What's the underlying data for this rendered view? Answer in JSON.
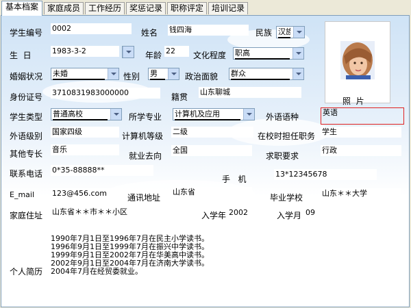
{
  "tabs": [
    "基本档案",
    "家庭成员",
    "工作经历",
    "奖惩记录",
    "职称评定",
    "培训记录"
  ],
  "labels": {
    "student_id": "学生编号",
    "name": "姓名",
    "ethnicity": "民族",
    "birthday": "生  日",
    "age": "年龄",
    "education": "文化程度",
    "marital": "婚姻状况",
    "gender": "性别",
    "political": "政治面貌",
    "id_number": "身份证号",
    "native_place": "籍贯",
    "photo": "照  片",
    "student_type": "学生类型",
    "major": "所学专业",
    "foreign_lang": "外语语种",
    "foreign_level": "外语级别",
    "computer_level": "计算机等级",
    "school_role": "在校时担任职务",
    "specialty": "其他专长",
    "employment": "就业去向",
    "job_request": "求职要求",
    "phone": "联系电话",
    "mobile": "手   机",
    "email": "E_mail",
    "address": "通讯地址",
    "graduated_from": "毕业学校",
    "home_address": "家庭住址",
    "enroll_year": "入学年",
    "enroll_month": "入学月",
    "resume": "个人简历"
  },
  "values": {
    "student_id": "0002",
    "name": "钱四海",
    "ethnicity": "汉族",
    "birthday": "1983-3-2",
    "age": "22",
    "education": "职高",
    "marital": "未婚",
    "gender": "男",
    "political": "群众",
    "id_number": "3710831983000000",
    "native_place": "山东聊城",
    "student_type": "普通高校",
    "major": "计算机及应用",
    "foreign_lang": "英语",
    "foreign_level": "国家四级",
    "computer_level": "二级",
    "school_role": "学生",
    "specialty": "音乐",
    "employment": "全国",
    "job_request": "行政",
    "phone": "0*35-88888**",
    "mobile": "13*12345678",
    "email": "123@456.com",
    "address": "山东省",
    "graduated_from": "山东＊＊大学",
    "home_address": "山东省＊＊市＊＊小区",
    "enroll_year": "2002",
    "enroll_month": "09",
    "resume": "1990年7月1日至1996年7月在民主小学读书。\n1996年9月1日至1999年7月在振兴中学读书。\n1999年9月1日至2002年7月在华美高中读书。\n2002年9月1日至2004年7月在济南大学读书。\n2004年7月在经贸委就业。"
  },
  "colors": {
    "panel_border": "#7f9db9",
    "highlight_border": "#e02020",
    "dropdown_button": "#c9dcf6"
  }
}
